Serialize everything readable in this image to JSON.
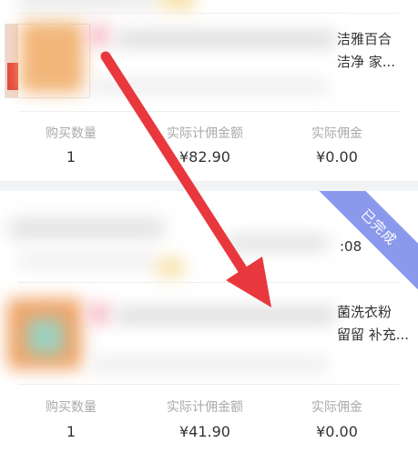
{
  "orders": [
    {
      "product_line1": "洁雅百合",
      "product_line2": "洁净 家...",
      "stats": [
        {
          "label": "购买数量",
          "value": "1"
        },
        {
          "label": "实际计佣金额",
          "value": "¥82.90"
        },
        {
          "label": "实际佣金",
          "value": "¥0.00"
        }
      ]
    },
    {
      "badge": "已完成",
      "time_fragment": ":08",
      "product_line1": "菌洗衣粉",
      "product_line2": "留留 补充...",
      "stats": [
        {
          "label": "购买数量",
          "value": "1"
        },
        {
          "label": "实际计佣金额",
          "value": "¥41.90"
        },
        {
          "label": "实际佣金",
          "value": "¥0.00"
        }
      ]
    }
  ],
  "colors": {
    "badge_bg": "#8a99ec",
    "arrow": "#e8383d",
    "label_gray": "#aaaaaa",
    "page_bg": "#f2f3f5"
  }
}
